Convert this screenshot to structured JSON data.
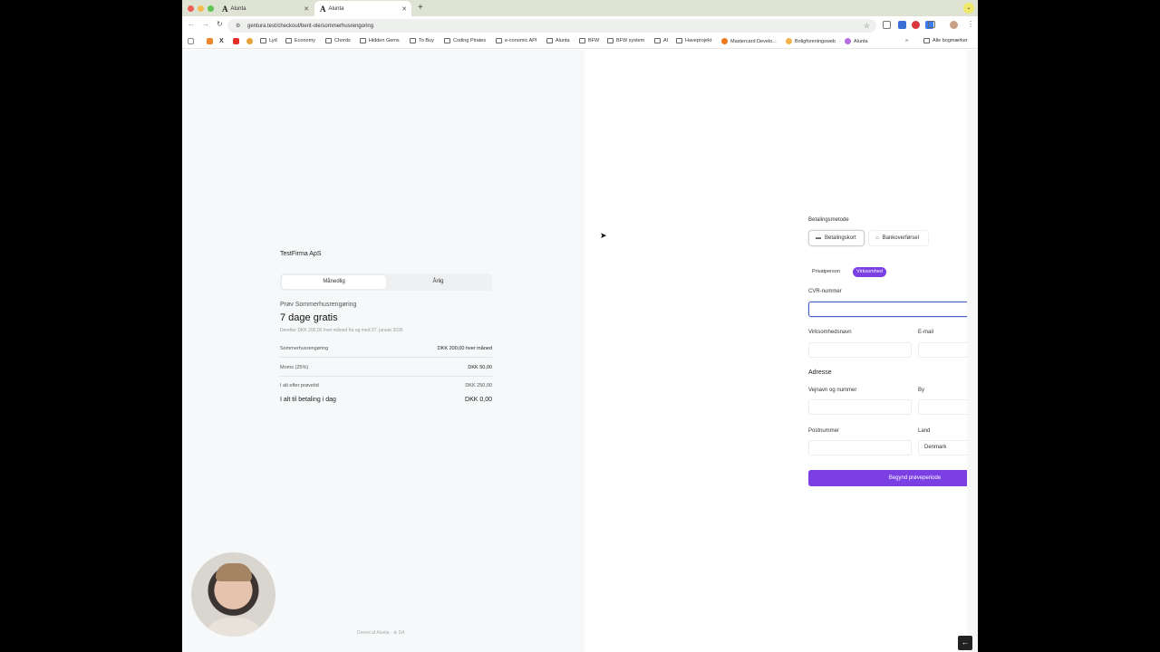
{
  "browser": {
    "tabs": [
      {
        "title": "Alunta",
        "active": false
      },
      {
        "title": "Alunta",
        "active": true
      }
    ],
    "url": "gentura.test/checkout/bent-ole/sommerhusrengoring",
    "bookmarks": [
      "Lyd",
      "Economy",
      "Chords",
      "Hidden Gems",
      "To Buy",
      "Coding Pirates",
      "e-conomic API",
      "Alunta",
      "BFW",
      "BFW system",
      "AI",
      "Haveprojekt",
      "Mastercard Develo...",
      "Boligforeningsweb",
      "Alunta"
    ],
    "all_bookmarks": "Alle bogmærker",
    "overflow": "»"
  },
  "summary": {
    "company": "TestFirma ApS",
    "billing_tabs": [
      "Månedlig",
      "Årlig"
    ],
    "try_label": "Prøv Sommerhusrengøring",
    "free_title": "7 dage gratis",
    "then_text": "Derefter DKK 200,00 hver måned fra og med 27. januar 2026",
    "lines": [
      {
        "label": "Sommerhusrengøring",
        "value": "DKK 200,00 hver måned"
      },
      {
        "label": "Moms (25%)",
        "value": "DKK 50,00"
      },
      {
        "label": "I alt efter prøvetid",
        "value": "DKK 250,00"
      },
      {
        "label": "I alt til betaling i dag",
        "value": "DKK 0,00"
      }
    ],
    "footer": "Drevet af Alunta · ⊕ DA"
  },
  "form": {
    "payment_method_label": "Betalingsmetode",
    "payment_methods": [
      "Betalingskort",
      "Bankoverførsel"
    ],
    "customer_types": [
      "Privatperson",
      "Virksomhed"
    ],
    "cvr_label": "CVR-nummer",
    "company_name_label": "Virksomhedsnavn",
    "email_label": "E-mail",
    "address_heading": "Adresse",
    "street_label": "Vejnavn og nummer",
    "city_label": "By",
    "postcode_label": "Postnummer",
    "country_label": "Land",
    "country_value": "Denmark",
    "submit_label": "Begynd prøveperiode"
  },
  "colors": {
    "accent": "#7b3fe4",
    "focus": "#4a5fc1"
  }
}
